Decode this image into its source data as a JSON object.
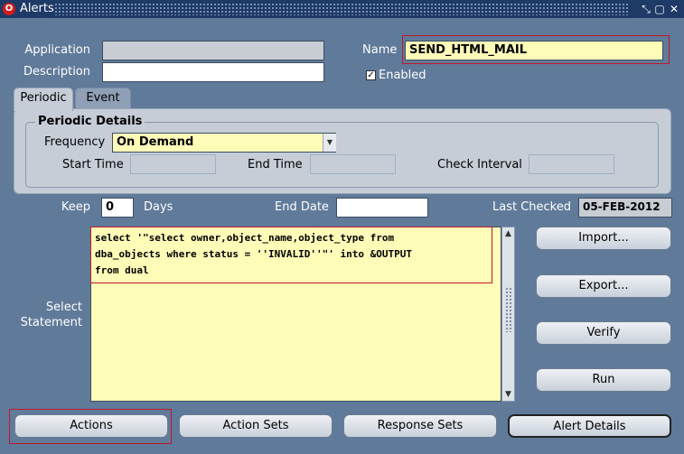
{
  "window": {
    "title": "Alerts",
    "controls": {
      "restore": "⤡",
      "maximize": "▢",
      "close": "✕"
    },
    "app_icon_letter": "O"
  },
  "form": {
    "application_label": "Application",
    "application_value": "",
    "description_label": "Description",
    "description_value": "",
    "name_label": "Name",
    "name_value": "SEND_HTML_MAIL",
    "enabled_label": "Enabled",
    "enabled_checked": true
  },
  "tabs": [
    {
      "label": "Periodic",
      "active": true
    },
    {
      "label": "Event",
      "active": false
    }
  ],
  "periodic": {
    "group_title": "Periodic Details",
    "frequency_label": "Frequency",
    "frequency_value": "On Demand",
    "start_time_label": "Start Time",
    "start_time_value": "",
    "end_time_label": "End Time",
    "end_time_value": "",
    "check_interval_label": "Check Interval",
    "check_interval_value": ""
  },
  "history": {
    "keep_label": "Keep",
    "keep_value": "0",
    "days_label": "Days",
    "end_date_label": "End Date",
    "end_date_value": "",
    "last_checked_label": "Last Checked",
    "last_checked_value": "05-FEB-2012"
  },
  "statement": {
    "label_line1": "Select",
    "label_line2": "Statement",
    "text": "select '\"select owner,object_name,object_type from\ndba_objects where status = ''INVALID''\"' into &OUTPUT\nfrom dual"
  },
  "side_buttons": {
    "import": "Import...",
    "export": "Export...",
    "verify": "Verify",
    "run": "Run"
  },
  "bottom_buttons": {
    "actions": "Actions",
    "action_sets": "Action Sets",
    "response_sets": "Response Sets",
    "alert_details": "Alert Details"
  },
  "colors": {
    "window_bg": "#607a9a",
    "titlebar": "#1e3a66",
    "required_yellow": "#fffcb8",
    "highlight_red": "#c0182a"
  }
}
